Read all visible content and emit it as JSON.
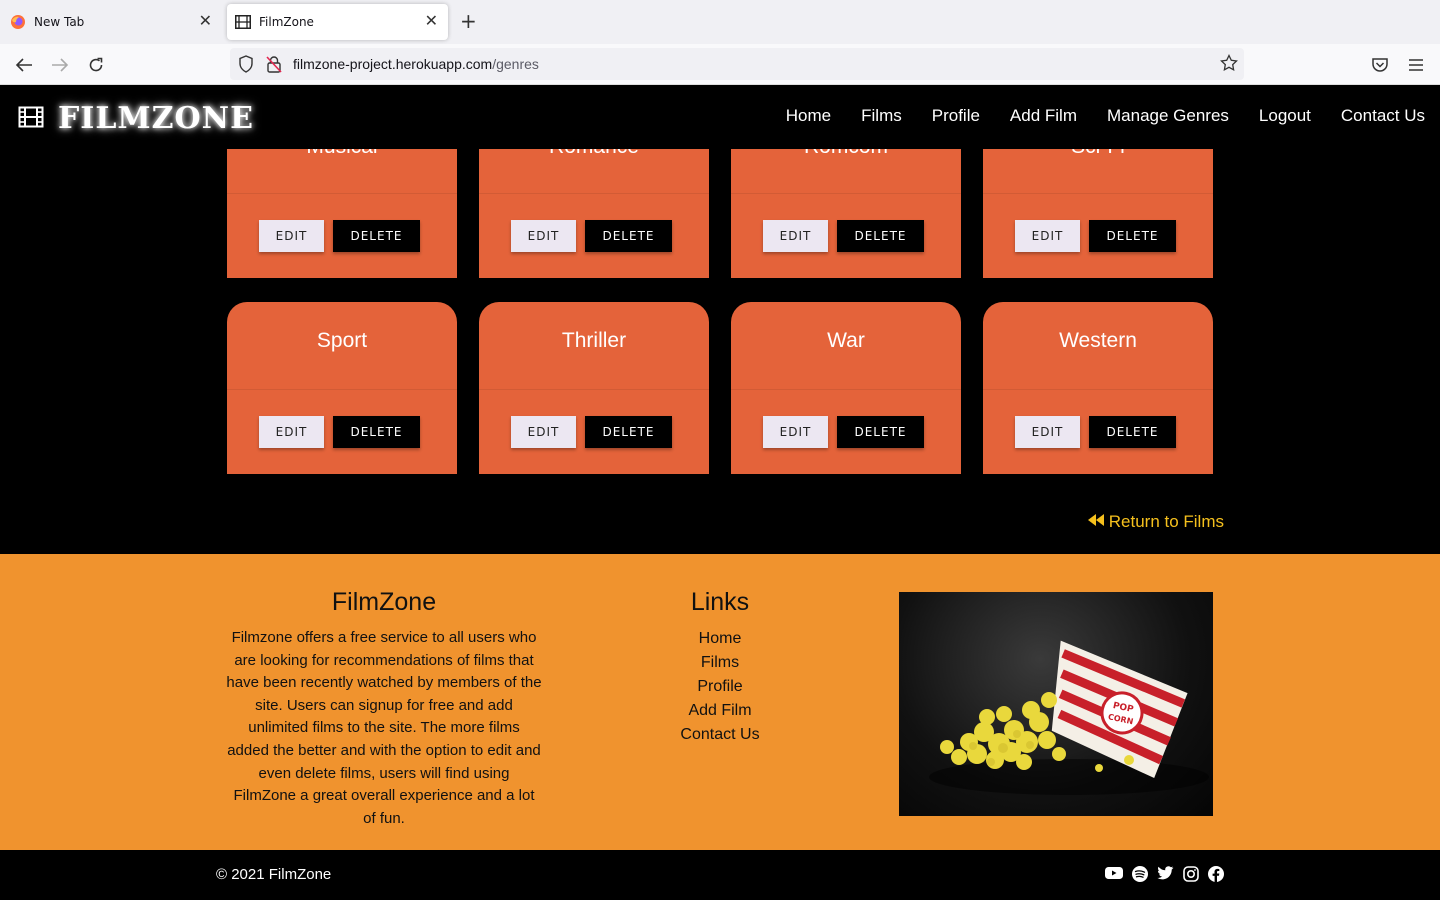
{
  "browser": {
    "tabs": [
      {
        "title": "New Tab",
        "active": false
      },
      {
        "title": "FilmZone",
        "active": true
      }
    ],
    "url_host": "filmzone-project.herokuapp.com",
    "url_path": "/genres"
  },
  "header": {
    "logo_text": "FILMZONE",
    "menu": [
      "Home",
      "Films",
      "Profile",
      "Add Film",
      "Manage Genres",
      "Logout",
      "Contact Us"
    ]
  },
  "genres_row1": [
    {
      "name": "Musical",
      "edit": "EDIT",
      "delete": "DELETE"
    },
    {
      "name": "Romance",
      "edit": "EDIT",
      "delete": "DELETE"
    },
    {
      "name": "Romcom",
      "edit": "EDIT",
      "delete": "DELETE"
    },
    {
      "name": "Sci-Fi",
      "edit": "EDIT",
      "delete": "DELETE"
    }
  ],
  "genres_row2": [
    {
      "name": "Sport",
      "edit": "EDIT",
      "delete": "DELETE"
    },
    {
      "name": "Thriller",
      "edit": "EDIT",
      "delete": "DELETE"
    },
    {
      "name": "War",
      "edit": "EDIT",
      "delete": "DELETE"
    },
    {
      "name": "Western",
      "edit": "EDIT",
      "delete": "DELETE"
    }
  ],
  "return_link": "Return to Films",
  "footer": {
    "about_title": "FilmZone",
    "about_text": "Filmzone offers a free service to all users who are looking for recommendations of films that have been recently watched by members of the site. Users can signup for free and add unlimited films to the site. The more films added the better and with the option to edit and even delete films, users will find using FilmZone a great overall experience and a lot of fun.",
    "links_title": "Links",
    "links": [
      "Home",
      "Films",
      "Profile",
      "Add Film",
      "Contact Us"
    ],
    "copyright": "© 2021 FilmZone",
    "socials": [
      "youtube-icon",
      "spotify-icon",
      "twitter-icon",
      "instagram-icon",
      "facebook-icon"
    ]
  },
  "colors": {
    "card": "#e4633a",
    "footer": "#f0932e",
    "return_link": "#f5c01d"
  }
}
